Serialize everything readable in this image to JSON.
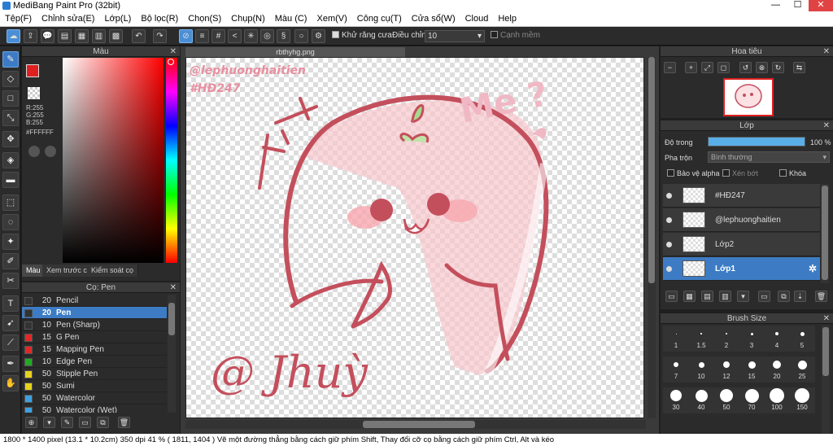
{
  "window": {
    "title": "MediBang Paint Pro (32bit)",
    "min": "—",
    "max": "☐",
    "close": "✕"
  },
  "menu": [
    "Tệp(F)",
    "Chỉnh sửa(E)",
    "Lớp(L)",
    "Bộ lọc(R)",
    "Chọn(S)",
    "Chụp(N)",
    "Màu (C)",
    "Xem(V)",
    "Công cụ(T)",
    "Cửa sổ(W)",
    "Cloud",
    "Help"
  ],
  "toolbar": {
    "antialias_label": "Khử răng cưa",
    "adjust_label": "Điều chỉnh",
    "adjust_value": "10",
    "edge_label": "Cạnh mềm"
  },
  "color_panel": {
    "title": "Màu",
    "r": "R:255",
    "g": "G:255",
    "b": "B:255",
    "hex": "#FFFFFF",
    "tabs": [
      "Màu",
      "Xem trước cọ",
      "Kiểm soát cọ"
    ],
    "primary": "#e02020",
    "secondary": "#ffffff"
  },
  "brush_panel": {
    "title": "Cọ: Pen",
    "items": [
      {
        "size": "20",
        "name": "Pencil",
        "color": "#333333"
      },
      {
        "size": "20",
        "name": "Pen",
        "color": "#333333",
        "selected": true
      },
      {
        "size": "10",
        "name": "Pen (Sharp)",
        "color": "#333333"
      },
      {
        "size": "15",
        "name": "G Pen",
        "color": "#e02828"
      },
      {
        "size": "15",
        "name": "Mapping Pen",
        "color": "#e02828"
      },
      {
        "size": "10",
        "name": "Edge Pen",
        "color": "#22aa22"
      },
      {
        "size": "50",
        "name": "Stipple Pen",
        "color": "#e6d21e"
      },
      {
        "size": "50",
        "name": "Sumi",
        "color": "#e6d21e"
      },
      {
        "size": "50",
        "name": "Watercolor",
        "color": "#3fa0e0"
      },
      {
        "size": "50",
        "name": "Watercolor (Wet)",
        "color": "#3fa0e0"
      }
    ]
  },
  "canvas": {
    "doc_tab": "rbthyhg.png",
    "watermark1": "@lephuonghaitien",
    "watermark2": "#HĐ247",
    "me_text": "Me ?",
    "signature": "@ Jhuỳ"
  },
  "navigator": {
    "title": "Hoa tiêu"
  },
  "layer_panel": {
    "title": "Lớp",
    "opacity_label": "Độ trong",
    "opacity_value": "100 %",
    "opacity": 1.0,
    "blend_label": "Pha trộn",
    "blend_value": "Bình thường",
    "protect_alpha": "Bảo vệ alpha",
    "clip": "Xén bớt",
    "lock": "Khóa",
    "layers": [
      {
        "name": "#HĐ247"
      },
      {
        "name": "@lephuonghaitien"
      },
      {
        "name": "Lớp2"
      },
      {
        "name": "Lớp1",
        "selected": true
      }
    ]
  },
  "brush_size": {
    "title": "Brush Size",
    "sizes": [
      "1",
      "1.5",
      "2",
      "3",
      "4",
      "5",
      "7",
      "10",
      "12",
      "15",
      "20",
      "25",
      "30",
      "40",
      "50",
      "70",
      "100",
      "150"
    ]
  },
  "status": "1800 * 1400 pixel   (13.1 * 10.2cm)   350 dpi   41 %   ( 1811, 1404 )   Vẽ một đường thẳng bằng cách giữ phím Shift, Thay đổi cỡ cọ bằng cách giữ phím Ctrl, Alt và kéo"
}
